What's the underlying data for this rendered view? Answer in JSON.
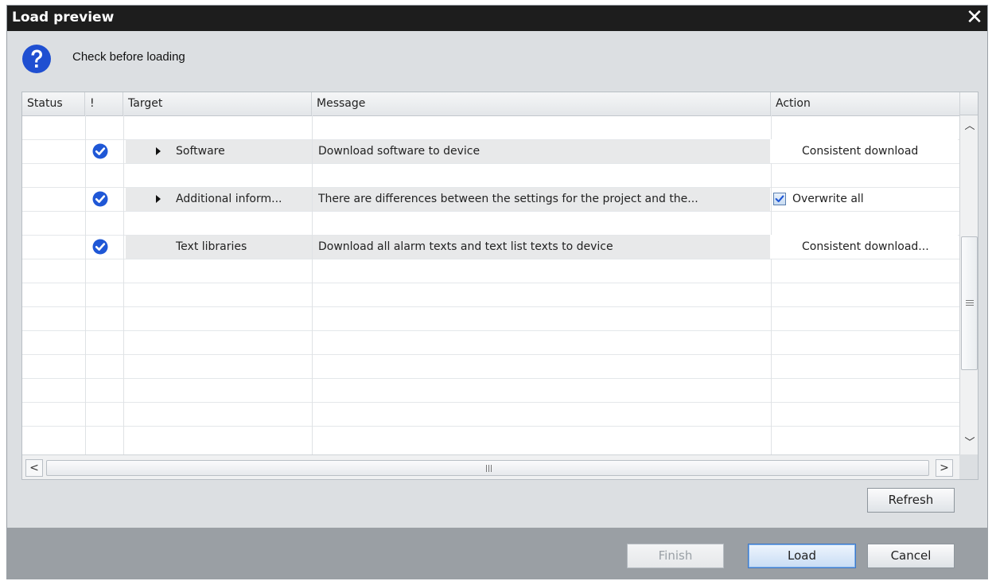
{
  "dialog": {
    "title": "Load preview",
    "close_label": "✕",
    "subtitle": "Check before loading",
    "help_icon": "question-icon"
  },
  "table": {
    "columns": [
      "Status",
      "!",
      "Target",
      "Message",
      "Action"
    ],
    "rows": [
      {
        "status_icon": "check-icon",
        "expandable": true,
        "target": "Software",
        "message": "Download software to device",
        "action": "Consistent download",
        "action_checkbox": false
      },
      {
        "status_icon": "check-icon",
        "expandable": true,
        "target": "Additional inform...",
        "message": "There are differences between the settings for the project and the...",
        "action": "Overwrite all",
        "action_checkbox": true
      },
      {
        "status_icon": "check-icon",
        "expandable": false,
        "target": "Text libraries",
        "message": "Download all alarm texts and text list texts to device",
        "action": "Consistent download...",
        "action_checkbox": false
      }
    ]
  },
  "scroll": {
    "up": "︿",
    "down": "﹀",
    "left": "<",
    "right": ">"
  },
  "buttons": {
    "refresh": "Refresh",
    "finish": "Finish",
    "load": "Load",
    "cancel": "Cancel"
  },
  "colors": {
    "title_bar": "#1d1d1d",
    "check_blue": "#1f57d6",
    "dialog_bg": "#dcdfe2",
    "footer_bg": "#9a9fa4"
  }
}
